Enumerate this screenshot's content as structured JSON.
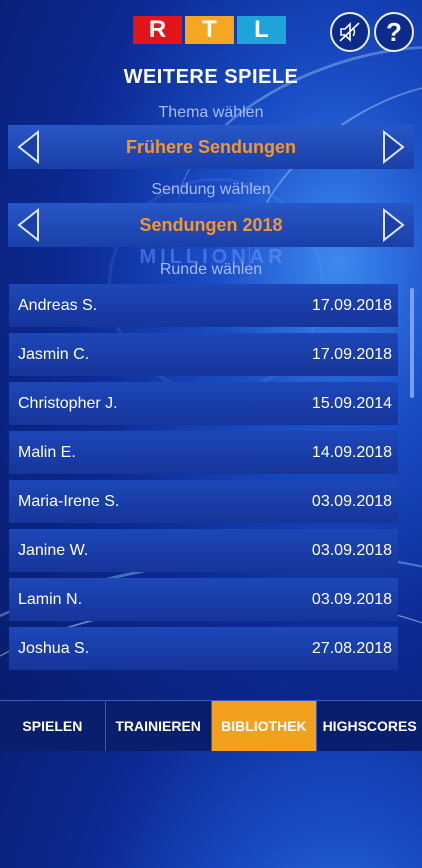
{
  "header": {
    "logo_letters": [
      "R",
      "T",
      "L"
    ],
    "sound_icon": "speaker-muted-icon",
    "help_label": "?"
  },
  "page_title": "WEITERE SPIELE",
  "theme": {
    "label": "Thema wählen",
    "value": "Frühere Sendungen"
  },
  "show": {
    "label": "Sendung wählen",
    "value": "Sendungen 2018"
  },
  "round_label": "Runde wählen",
  "emblem_text": "MILLIONÄR",
  "rounds": [
    {
      "name": "Andreas S.",
      "date": "17.09.2018"
    },
    {
      "name": "Jasmin C.",
      "date": "17.09.2018"
    },
    {
      "name": "Christopher J.",
      "date": "15.09.2014"
    },
    {
      "name": "Malin E.",
      "date": "14.09.2018"
    },
    {
      "name": "Maria-Irene S.",
      "date": "03.09.2018"
    },
    {
      "name": "Janine W.",
      "date": "03.09.2018"
    },
    {
      "name": "Lamin N.",
      "date": "03.09.2018"
    },
    {
      "name": "Joshua S.",
      "date": "27.08.2018"
    }
  ],
  "tabs": [
    {
      "label": "SPIELEN",
      "active": false
    },
    {
      "label": "TRAINIEREN",
      "active": false
    },
    {
      "label": "BIBLIOTHEK",
      "active": true
    },
    {
      "label": "HIGHSCORES",
      "active": false
    }
  ],
  "colors": {
    "accent": "#f6962b",
    "tab_active": "#f3a01e",
    "row": "#1d47b8"
  }
}
